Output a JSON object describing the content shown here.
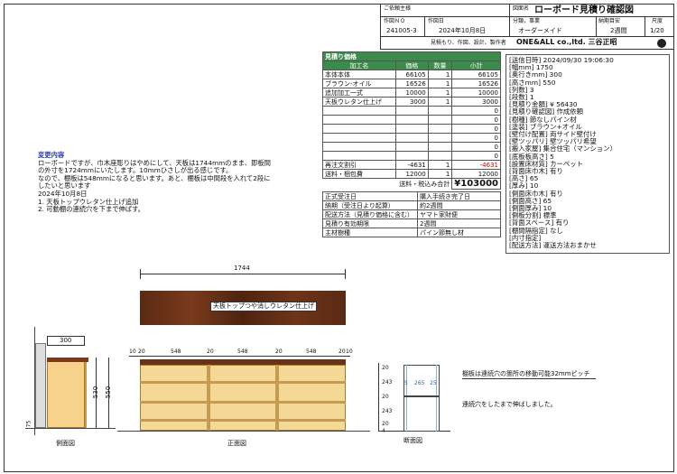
{
  "header": {
    "customer_label": "ご依頼主様",
    "drawing_name_label": "図面名",
    "drawing_name": "ローボード見積り確認図",
    "doc_no_label": "作図ＮＯ",
    "doc_no": "241005-3",
    "date_label": "作図日",
    "date": "2024年10月8日",
    "category_label": "分類，事業",
    "category": "オーダーメイド",
    "delivery_label": "納期目安",
    "delivery": "2週間",
    "scale_label": "尺度",
    "scale": "1/20",
    "maker_label": "見積もり、作図、設計、製作者",
    "maker": "ONE&ALL co.,ltd. 三谷正昭"
  },
  "estimate": {
    "title": "見積り価格",
    "col_item": "加工名",
    "col_price": "価格",
    "col_qty": "数量",
    "col_subtotal": "小計",
    "rows": [
      {
        "name": "本体本体",
        "price": "66105",
        "qty": "1",
        "subtotal": "66105"
      },
      {
        "name": "ブラウン-オイル",
        "price": "16526",
        "qty": "1",
        "subtotal": "16526"
      },
      {
        "name": "追加加工一式",
        "price": "10000",
        "qty": "1",
        "subtotal": "10000"
      },
      {
        "name": "天板ウレタン仕上げ",
        "price": "3000",
        "qty": "1",
        "subtotal": "3000"
      },
      {
        "name": "",
        "price": "",
        "qty": "",
        "subtotal": "0"
      },
      {
        "name": "",
        "price": "",
        "qty": "",
        "subtotal": "0"
      },
      {
        "name": "",
        "price": "",
        "qty": "",
        "subtotal": "0"
      },
      {
        "name": "",
        "price": "",
        "qty": "",
        "subtotal": "0"
      },
      {
        "name": "",
        "price": "",
        "qty": "",
        "subtotal": "0"
      },
      {
        "name": "",
        "price": "",
        "qty": "",
        "subtotal": "0"
      }
    ],
    "discount_name": "再注文割引",
    "discount_price": "-4631",
    "discount_qty": "1",
    "discount_subtotal": "-4631",
    "shipping_name": "送料・梱包費",
    "shipping_price": "12000",
    "shipping_qty": "1",
    "shipping_subtotal": "12000",
    "total_label": "送料・税込み合計",
    "total": "¥103000",
    "info": [
      {
        "k": "正式受注日",
        "v": "購入手続き完了日"
      },
      {
        "k": "納期（受注日より起算）",
        "v": "約2週間"
      },
      {
        "k": "配送方法（見積り価格に含む）",
        "v": "ヤマト家財便"
      },
      {
        "k": "見積り有効期限",
        "v": "2週間"
      },
      {
        "k": "主材樹種",
        "v": "パイン節無し材"
      }
    ]
  },
  "specs": [
    "[送信日時] 2024/09/30 19:06:30",
    "[幅mm] 1750",
    "[奥行きmm] 300",
    "[高さmm] 550",
    "[列数] 3",
    "[段数] 1",
    "[見積り金額] ¥ 56430",
    "[見積り確認図] 作成依頼",
    "[樹種] 節なしパイン材",
    "[塗装] ブラウン+オイル",
    "[壁付け配置] 両サイド壁付け",
    "[壁ツッパリ] 壁ツッパリ希望",
    "[搬入家屋] 集合住宅（マンション）",
    "[底板板高さ] 5",
    "[設置床材質] カーペット",
    "[背面床巾木] 有り",
    "[高さ] 65",
    "[厚み] 10",
    "[側面床巾木] 有り",
    "[側面高さ] 65",
    "[側面厚み] 10",
    "[側板分割] 標準",
    "[背面スペース] 有り",
    "[棚間隔指定] なし",
    "[内寸指定]",
    "[配送方法] 運送方法おまかせ"
  ],
  "notes": {
    "title": "変更内容",
    "lines": [
      "ローボードですが、巾木座彫りはやめにして、天板は1744mmのまま、即板間",
      "の外寸を1724mmにいたします。10mmひさしが出る感じです。",
      "なので、棚板は548mmになると思います。あと、棚板は中間段を入れて2段に",
      "したいと思います",
      "2024年10月8日",
      "1. 天板トップウレタン仕上げ追加",
      "2. 可動棚の連続穴を下まで伸ばす。"
    ]
  },
  "drawing": {
    "top_width": "1744",
    "top_label": "天板トップつや消しウレタン仕上げ",
    "side_depth": "300",
    "side_height": "550",
    "side_inner": "530",
    "side_plinth": "75",
    "front_dims": [
      "10",
      "20",
      "548",
      "20",
      "548",
      "20",
      "548",
      "20",
      "10"
    ],
    "section_dims": [
      "5",
      "265",
      "25"
    ],
    "section_heights": [
      "20",
      "243",
      "20",
      "243",
      "20",
      "4"
    ],
    "side_caption": "側面図",
    "front_caption": "正面図",
    "section_caption": "断面図",
    "shelf_note_1": "棚板は連続穴の箇所の移動可能32mmピッチ",
    "shelf_note_2": "連続穴をしたまで伸ばしました。"
  }
}
